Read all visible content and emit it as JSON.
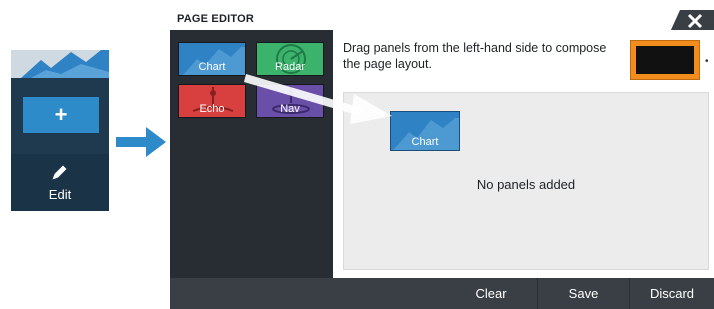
{
  "mini_menu": {
    "add_symbol": "+",
    "edit_label": "Edit",
    "icons": [
      "chart-thumbnail-icon",
      "plus-icon",
      "pencil-icon"
    ]
  },
  "dialog": {
    "title": "PAGE EDITOR",
    "close_icon": "close-x-icon",
    "instructions": "Drag panels from the left-hand side to compose the page layout.",
    "empty_message": "No panels added",
    "dragging_panel_label": "Chart",
    "color_swatch": {
      "outer": "#f28c1c",
      "inner": "#111111"
    },
    "panels": [
      {
        "label": "Chart",
        "color": "#2f82c3",
        "icon": "chart-icon"
      },
      {
        "label": "Radar",
        "color": "#3bb36c",
        "icon": "radar-icon"
      },
      {
        "label": "Echo",
        "color": "#d8403f",
        "icon": "echo-icon"
      },
      {
        "label": "Nav",
        "color": "#6a4fa9",
        "icon": "nav-icon"
      }
    ],
    "buttons": {
      "clear": "Clear",
      "save": "Save",
      "discard": "Discard"
    }
  }
}
